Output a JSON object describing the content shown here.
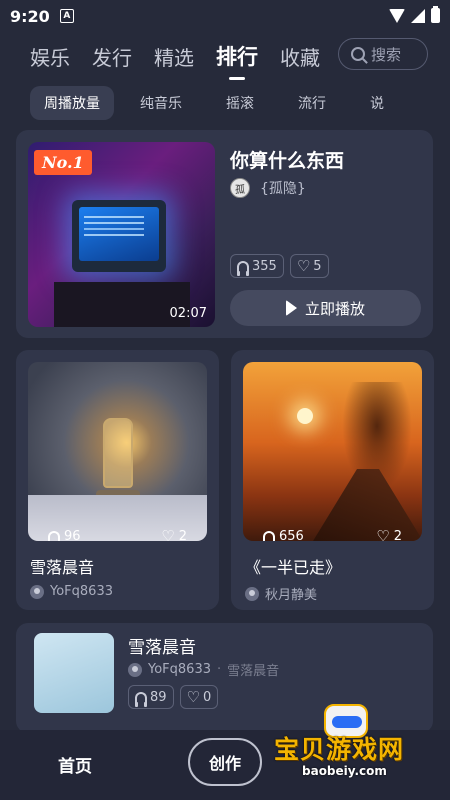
{
  "status_bar": {
    "time": "9:20",
    "notification_glyph": "A"
  },
  "top_tabs": [
    {
      "label": "娱乐",
      "active": false
    },
    {
      "label": "发行",
      "active": false
    },
    {
      "label": "精选",
      "active": false
    },
    {
      "label": "排行",
      "active": true
    },
    {
      "label": "收藏",
      "active": false
    }
  ],
  "search": {
    "placeholder": "搜索"
  },
  "sub_tabs": [
    {
      "label": "周播放量",
      "active": true
    },
    {
      "label": "纯音乐",
      "active": false
    },
    {
      "label": "摇滚",
      "active": false
    },
    {
      "label": "流行",
      "active": false
    },
    {
      "label": "说",
      "active": false
    }
  ],
  "featured": {
    "rank_badge": "No.1",
    "duration": "02:07",
    "title": "你算什么东西",
    "artist_avatar_text": "孤",
    "artist": "{孤隐}",
    "plays": "355",
    "likes": "5",
    "play_button": "立即播放"
  },
  "grid": [
    {
      "title": "雪落晨音",
      "user": "YoFq8633",
      "plays": "96",
      "likes": "2"
    },
    {
      "title": "《一半已走》",
      "user": "秋月静美",
      "plays": "656",
      "likes": "2"
    }
  ],
  "list": [
    {
      "title": "雪落晨音",
      "user": "YoFq8633",
      "separator": "·",
      "album": "雪落晨音",
      "plays": "89",
      "likes": "0"
    }
  ],
  "bottom_nav": {
    "home": "首页",
    "create": "创作"
  },
  "watermark": {
    "text": "宝贝游戏网",
    "url": "baobeiy.com"
  },
  "colors": {
    "background": "#262a3a",
    "card": "#31364a",
    "rank_badge": "#ff5b2e",
    "watermark": "#f4b400"
  }
}
